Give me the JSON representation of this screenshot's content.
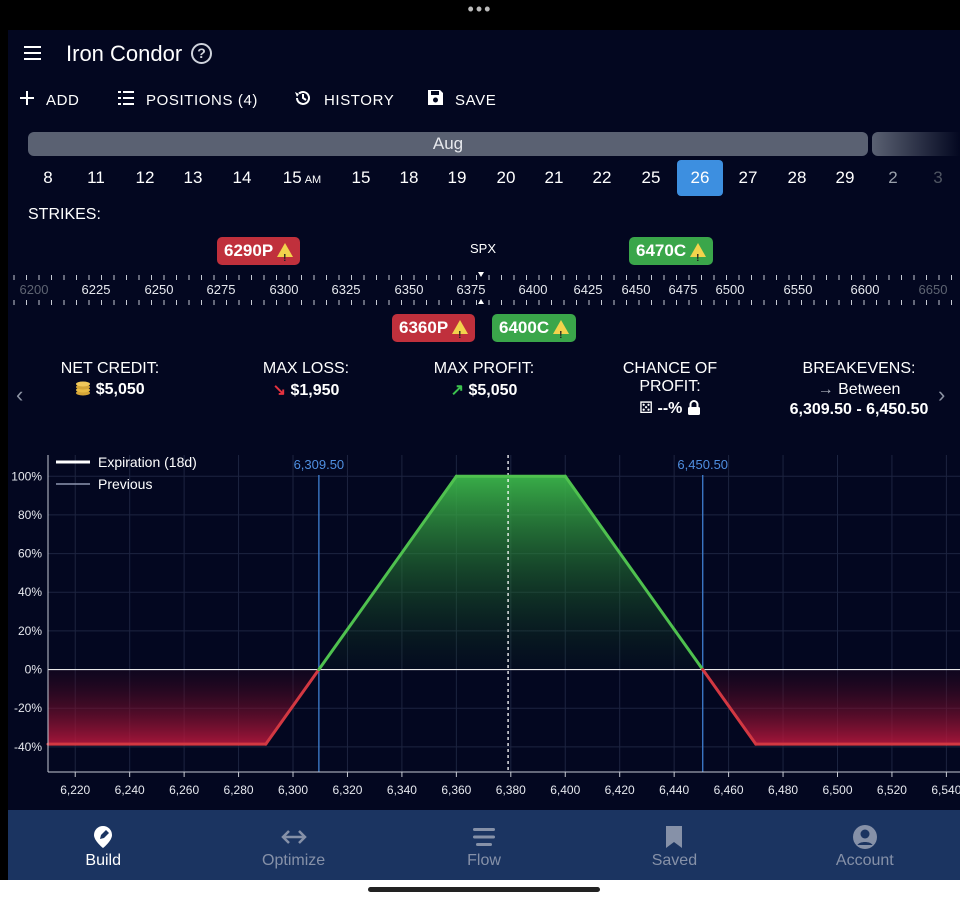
{
  "header": {
    "title": "Iron Condor",
    "help_glyph": "?"
  },
  "toolbar": {
    "add_label": "ADD",
    "positions_label": "POSITIONS (4)",
    "history_label": "HISTORY",
    "save_label": "SAVE"
  },
  "dates": {
    "month": "Aug",
    "days": [
      {
        "label": "8"
      },
      {
        "label": "11"
      },
      {
        "label": "12"
      },
      {
        "label": "13"
      },
      {
        "label": "14"
      },
      {
        "label": "15",
        "suffix": "AM"
      },
      {
        "label": "15"
      },
      {
        "label": "18"
      },
      {
        "label": "19"
      },
      {
        "label": "20"
      },
      {
        "label": "21"
      },
      {
        "label": "22"
      },
      {
        "label": "25"
      },
      {
        "label": "26",
        "selected": true
      },
      {
        "label": "27"
      },
      {
        "label": "28"
      },
      {
        "label": "29"
      },
      {
        "label": "2"
      },
      {
        "label": "3"
      }
    ]
  },
  "strikes": {
    "label": "STRIKES:",
    "underlying": "SPX",
    "scale": [
      "6200",
      "6225",
      "6250",
      "6275",
      "6300",
      "6325",
      "6350",
      "6375",
      "6400",
      "6425",
      "6450",
      "6475",
      "6500",
      "6550",
      "6600",
      "6650"
    ],
    "legs": [
      {
        "label": "6290P",
        "color": "red",
        "position": "top"
      },
      {
        "label": "6470C",
        "color": "green",
        "position": "top"
      },
      {
        "label": "6360P",
        "color": "red",
        "position": "bottom"
      },
      {
        "label": "6400C",
        "color": "green",
        "position": "bottom"
      }
    ]
  },
  "stats": {
    "net_credit": {
      "label": "NET CREDIT:",
      "value": "$5,050"
    },
    "max_loss": {
      "label": "MAX LOSS:",
      "value": "$1,950"
    },
    "max_profit": {
      "label": "MAX PROFIT:",
      "value": "$5,050"
    },
    "chance": {
      "label_line1": "CHANCE OF",
      "label_line2": "PROFIT:",
      "value": "--%"
    },
    "breakevens": {
      "label": "BREAKEVENS:",
      "between": "Between",
      "value": "6,309.50 - 6,450.50"
    }
  },
  "chart_data": {
    "type": "line",
    "legend": [
      "Expiration (18d)",
      "Previous"
    ],
    "x_ticks": [
      "6,220",
      "6,240",
      "6,260",
      "6,280",
      "6,300",
      "6,320",
      "6,340",
      "6,360",
      "6,380",
      "6,400",
      "6,420",
      "6,440",
      "6,460",
      "6,480",
      "6,500",
      "6,520",
      "6,540"
    ],
    "y_ticks": [
      "100%",
      "80%",
      "60%",
      "40%",
      "20%",
      "0%",
      "-20%",
      "-40%"
    ],
    "xlim": [
      6210,
      6545
    ],
    "ylim": [
      -53,
      111
    ],
    "breakeven_labels": [
      "6,309.50",
      "6,450.50"
    ],
    "breakevens": [
      6309.5,
      6450.5
    ],
    "current_price": 6379,
    "series": [
      {
        "name": "Expiration (18d)",
        "x": [
          6210,
          6290,
          6309.5,
          6360,
          6400,
          6450.5,
          6470,
          6545
        ],
        "y": [
          -38.6,
          -38.6,
          0,
          100,
          100,
          0,
          -38.6,
          -38.6
        ]
      }
    ]
  },
  "nav": {
    "items": [
      {
        "label": "Build",
        "active": true
      },
      {
        "label": "Optimize"
      },
      {
        "label": "Flow"
      },
      {
        "label": "Saved"
      },
      {
        "label": "Account"
      }
    ]
  }
}
